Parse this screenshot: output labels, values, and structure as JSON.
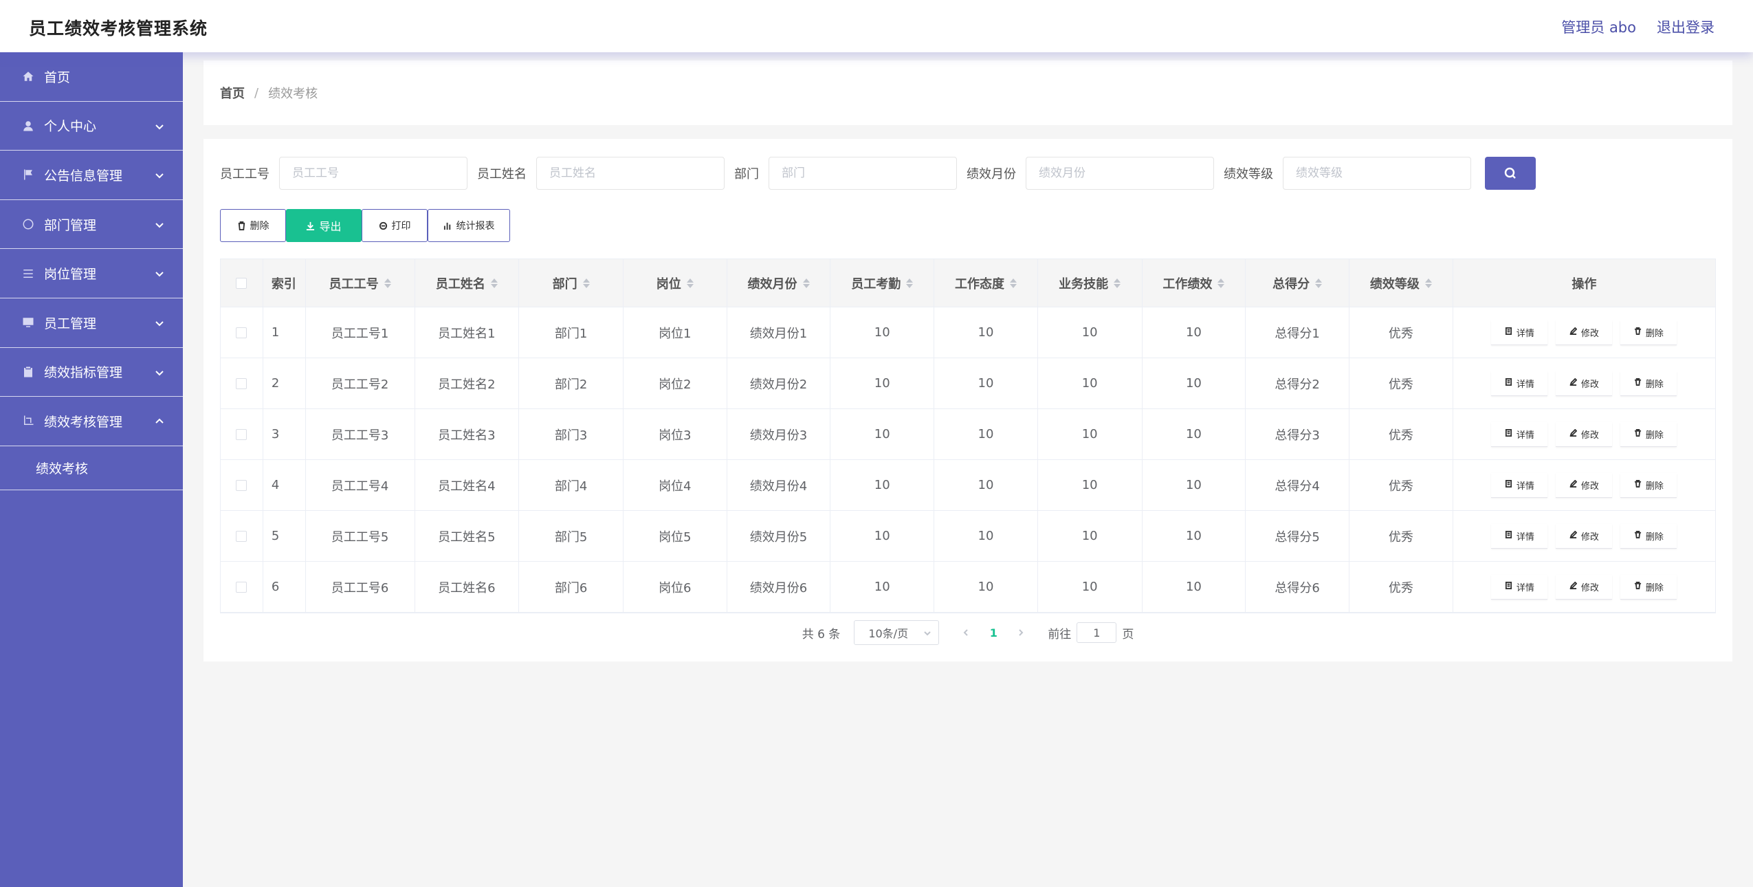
{
  "header": {
    "title": "员工绩效考核管理系统",
    "user_label": "管理员 abo",
    "logout_label": "退出登录"
  },
  "sidebar": {
    "items": [
      {
        "label": "首页",
        "icon": "home-icon"
      },
      {
        "label": "个人中心",
        "icon": "user-icon"
      },
      {
        "label": "公告信息管理",
        "icon": "flag-icon"
      },
      {
        "label": "部门管理",
        "icon": "power-icon"
      },
      {
        "label": "岗位管理",
        "icon": "list-icon"
      },
      {
        "label": "员工管理",
        "icon": "monitor-icon"
      },
      {
        "label": "绩效指标管理",
        "icon": "clipboard-icon"
      },
      {
        "label": "绩效考核管理",
        "icon": "crop-icon"
      }
    ],
    "sub_item": "绩效考核"
  },
  "breadcrumb": {
    "home": "首页",
    "separator": "/",
    "current": "绩效考核"
  },
  "search": {
    "emp_no_label": "员工工号",
    "emp_no_placeholder": "员工工号",
    "emp_name_label": "员工姓名",
    "emp_name_placeholder": "员工姓名",
    "dept_label": "部门",
    "dept_placeholder": "部门",
    "month_label": "绩效月份",
    "month_placeholder": "绩效月份",
    "grade_label": "绩效等级",
    "grade_placeholder": "绩效等级"
  },
  "toolbar": {
    "delete": "删除",
    "export": "导出",
    "print": "打印",
    "report": "统计报表"
  },
  "table": {
    "headers": [
      "索引",
      "员工工号",
      "员工姓名",
      "部门",
      "岗位",
      "绩效月份",
      "员工考勤",
      "工作态度",
      "业务技能",
      "工作绩效",
      "总得分",
      "绩效等级",
      "操作"
    ],
    "rows": [
      [
        "1",
        "员工工号1",
        "员工姓名1",
        "部门1",
        "岗位1",
        "绩效月份1",
        "10",
        "10",
        "10",
        "10",
        "总得分1",
        "优秀"
      ],
      [
        "2",
        "员工工号2",
        "员工姓名2",
        "部门2",
        "岗位2",
        "绩效月份2",
        "10",
        "10",
        "10",
        "10",
        "总得分2",
        "优秀"
      ],
      [
        "3",
        "员工工号3",
        "员工姓名3",
        "部门3",
        "岗位3",
        "绩效月份3",
        "10",
        "10",
        "10",
        "10",
        "总得分3",
        "优秀"
      ],
      [
        "4",
        "员工工号4",
        "员工姓名4",
        "部门4",
        "岗位4",
        "绩效月份4",
        "10",
        "10",
        "10",
        "10",
        "总得分4",
        "优秀"
      ],
      [
        "5",
        "员工工号5",
        "员工姓名5",
        "部门5",
        "岗位5",
        "绩效月份5",
        "10",
        "10",
        "10",
        "10",
        "总得分5",
        "优秀"
      ],
      [
        "6",
        "员工工号6",
        "员工姓名6",
        "部门6",
        "岗位6",
        "绩效月份6",
        "10",
        "10",
        "10",
        "10",
        "总得分6",
        "优秀"
      ]
    ],
    "actions": {
      "detail": "详情",
      "edit": "修改",
      "delete": "删除"
    }
  },
  "pagination": {
    "total": "共 6 条",
    "page_size": "10条/页",
    "current_page": "1",
    "goto_prefix": "前往",
    "goto_value": "1",
    "goto_suffix": "页"
  },
  "colors": {
    "primary": "#5b5fba",
    "success": "#19c191",
    "background": "#f5f5f5"
  }
}
